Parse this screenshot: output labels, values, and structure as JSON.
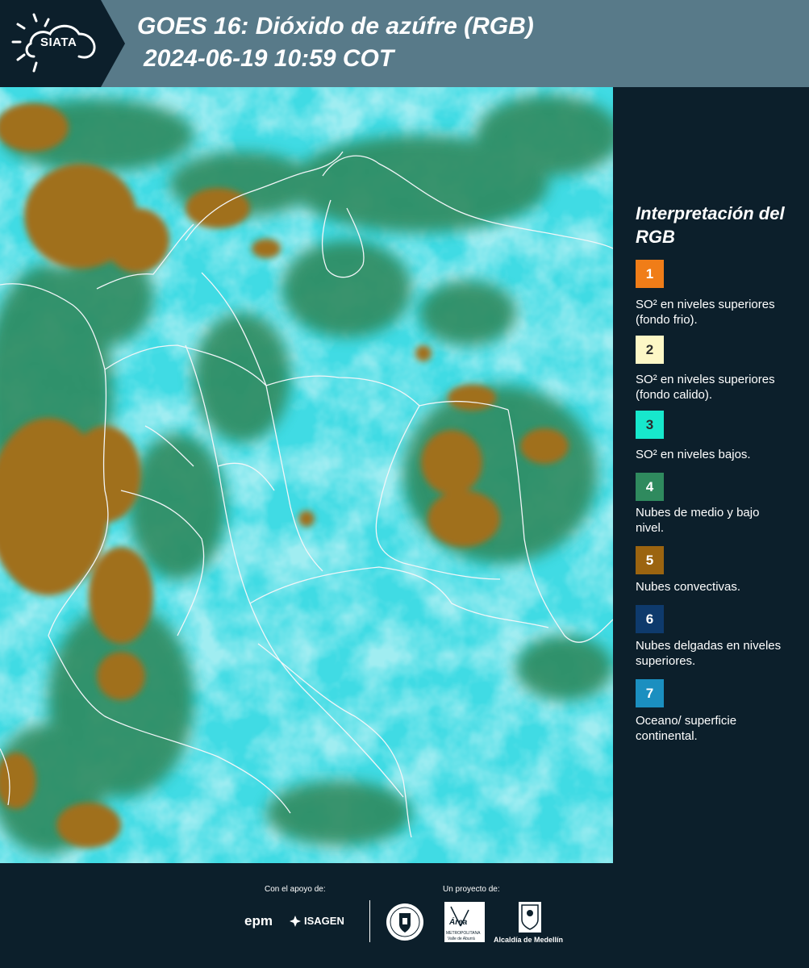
{
  "header": {
    "logo_text": "SIATA",
    "title_line1": "GOES 16: Dióxido de azúfre (RGB)",
    "title_line2": "2024-06-19 10:59 COT"
  },
  "legend": {
    "title": "Interpretación del RGB",
    "items": [
      {
        "number": "1",
        "color": "#f07d18",
        "text": "SO² en niveles superiores (fondo frio)."
      },
      {
        "number": "2",
        "color": "#fdf7c6",
        "text": "SO² en niveles superiores (fondo calido)."
      },
      {
        "number": "3",
        "color": "#17e8cc",
        "text": "SO² en niveles bajos."
      },
      {
        "number": "4",
        "color": "#2f8a5e",
        "text": "Nubes de medio y bajo nivel."
      },
      {
        "number": "5",
        "color": "#9b6410",
        "text": "Nubes convectivas."
      },
      {
        "number": "6",
        "color": "#0e3a6c",
        "text": "Nubes delgadas en niveles superiores."
      },
      {
        "number": "7",
        "color": "#1b8fc0",
        "text": "Oceano/ superficie continental."
      }
    ]
  },
  "footer": {
    "support_label": "Con el apoyo de:",
    "project_label": "Un proyecto de:",
    "sponsor_epm": "epm",
    "sponsor_isagen": "ISAGEN",
    "partner_area_top": "Área",
    "partner_area_sub": "METROPOLITANA",
    "partner_area_sub2": "Valle de Aburrá",
    "partner_alcaldia": "Alcaldía de Medellín"
  },
  "colors": {
    "background": "#0c1f2b",
    "header_band": "#587a89",
    "map_cyan": "#3fdde6",
    "map_green": "#2f8a5e",
    "map_brown": "#a0701c",
    "borders": "#f2f6f8"
  }
}
